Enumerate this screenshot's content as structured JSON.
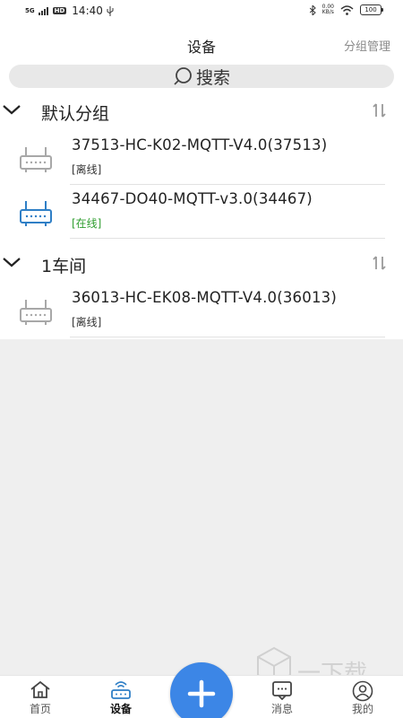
{
  "status_bar": {
    "network": "5G",
    "hd": "HD",
    "time": "14:40",
    "speed_value": "0.00",
    "speed_unit": "KB/s",
    "battery": "100"
  },
  "header": {
    "title": "设备",
    "right_action": "分组管理"
  },
  "search": {
    "label": "搜索"
  },
  "groups": [
    {
      "name": "默认分组",
      "devices": [
        {
          "name": "37513-HC-K02-MQTT-V4.0(37513)",
          "status": "[离线]",
          "online": false
        },
        {
          "name": "34467-DO40-MQTT-v3.0(34467)",
          "status": "[在线]",
          "online": true
        }
      ]
    },
    {
      "name": "1车间",
      "devices": [
        {
          "name": "36013-HC-EK08-MQTT-V4.0(36013)",
          "status": "[离线]",
          "online": false
        }
      ]
    }
  ],
  "tabbar": {
    "home": "首页",
    "devices": "设备",
    "messages": "消息",
    "mine": "我的"
  },
  "colors": {
    "accent": "#3c86e6",
    "online": "#2e9d2e",
    "offline_icon": "#a8a8a8",
    "online_icon": "#2f7fc6"
  },
  "watermark": {
    "text": "一下载",
    "sub": "yx...com"
  }
}
